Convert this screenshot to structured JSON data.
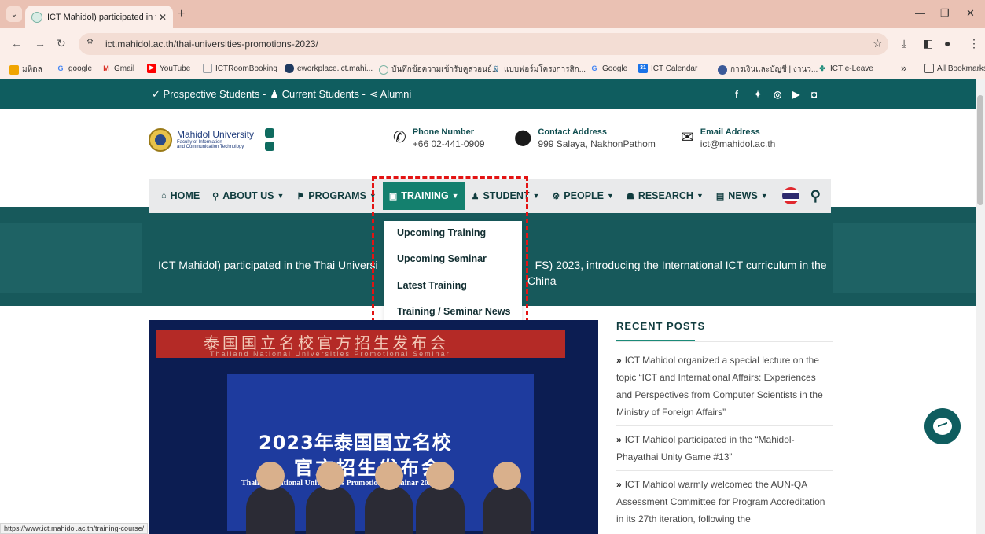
{
  "browser": {
    "tab_title": "ICT Mahidol) participated in the",
    "url": "ict.mahidol.ac.th/thai-universities-promotions-2023/",
    "status_url": "https://www.ict.mahidol.ac.th/training-course/",
    "bookmarks": [
      {
        "label": "มหิดล",
        "icon": "mahidol-icon",
        "color": "#f0a400"
      },
      {
        "label": "google",
        "icon": "google-icon",
        "color": "#4285f4"
      },
      {
        "label": "Gmail",
        "icon": "gmail-icon",
        "color": "#d93025"
      },
      {
        "label": "YouTube",
        "icon": "youtube-icon",
        "color": "#ff0000"
      },
      {
        "label": "ICTRoomBooking",
        "icon": "page-icon",
        "color": "#9aa0a6"
      },
      {
        "label": "eworkplace.ict.mahi...",
        "icon": "globe-icon",
        "color": "#1f3a60"
      },
      {
        "label": "บันทึกข้อความเข้ารับคูสวอนย์...",
        "icon": "ict-icon",
        "color": "#7bb4a4"
      },
      {
        "label": "แบบฟอร์มโครงการสิก...",
        "icon": "ict-icon",
        "color": "#3d7a9e"
      },
      {
        "label": "Google",
        "icon": "google-icon",
        "color": "#4285f4"
      },
      {
        "label": "ICT Calendar",
        "icon": "calendar-icon",
        "color": "#1a73e8"
      },
      {
        "label": "การเงินและบัญชี | งานว...",
        "icon": "finance-icon",
        "color": "#3b5998"
      },
      {
        "label": "ICT e-Leave",
        "icon": "leave-icon",
        "color": "#1b8a78"
      }
    ],
    "all_bookmarks": "All Bookmarks",
    "overflow": "»"
  },
  "topbar": {
    "links": [
      "✓ Prospective Students -",
      "♟ Current Students -",
      "⋖ Alumni"
    ],
    "social_icons": [
      "facebook-icon",
      "twitter-icon",
      "instagram-icon",
      "youtube-icon",
      "line-icon"
    ]
  },
  "header": {
    "university": "Mahidol University",
    "faculty_line1": "Faculty of Information",
    "faculty_line2": "and Communication Technology",
    "phone_label": "Phone Number",
    "phone_value": "+66 02-441-0909",
    "address_label": "Contact Address",
    "address_value": "999 Salaya, NakhonPathom",
    "email_label": "Email Address",
    "email_value": "ict@mahidol.ac.th"
  },
  "nav": {
    "home": "HOME",
    "about": "ABOUT US",
    "programs": "PROGRAMS",
    "training": "TRAINING",
    "student": "STUDENT",
    "people": "PEOPLE",
    "research": "RESEARCH",
    "news": "NEWS"
  },
  "dropdown": {
    "items": [
      "Upcoming Training",
      "Upcoming Seminar",
      "Latest Training",
      "Training / Seminar News"
    ]
  },
  "hero": {
    "title_left": "ICT Mahidol) participated in the Thai Universi",
    "title_right": "FS) 2023, introducing the International ICT curriculum in the",
    "title_line2": "China"
  },
  "photo": {
    "banner_cn": "泰国国立名校官方招生发布会",
    "banner_en": "Thailand National Universities Promotional Seminar",
    "screen_cn1": "2023年泰国国立名校",
    "screen_cn2": "官方招生发布会",
    "screen_en": "Thailand National Universities Promotional Seminar 2023"
  },
  "sidebar": {
    "title": "RECENT POSTS",
    "posts": [
      "ICT Mahidol organized a special lecture on the topic “ICT and International Affairs: Experiences and Perspectives from Computer Scientists in the Ministry of Foreign Affairs”",
      "ICT Mahidol participated in the “Mahidol-Phayathai Unity Game #13”",
      "ICT Mahidol warmly welcomed the AUN-QA Assessment Committee for Program Accreditation in its 27th iteration, following the"
    ]
  },
  "colors": {
    "teal_dark": "#0f5d5f",
    "teal_active": "#14806e",
    "highlight_red": "#e31313"
  }
}
